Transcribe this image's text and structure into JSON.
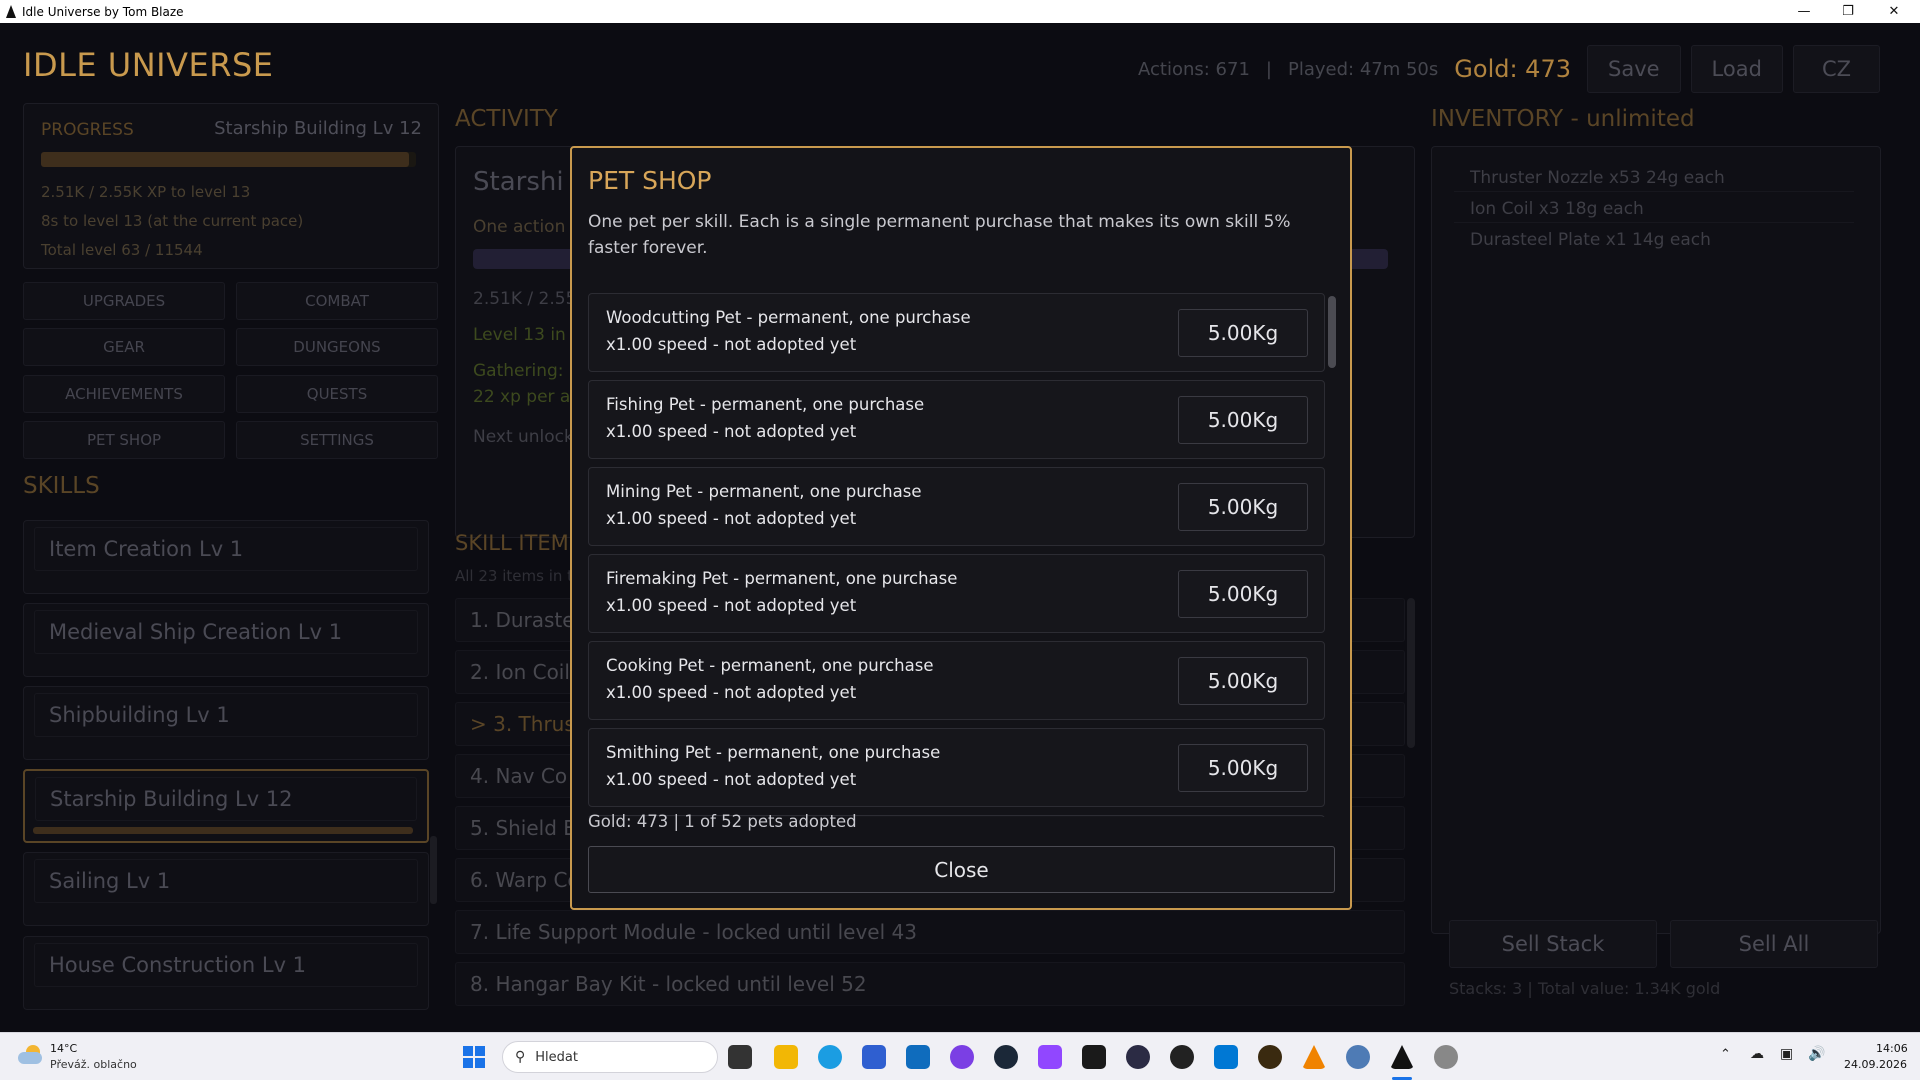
{
  "window": {
    "title": "Idle Universe by Tom Blaze"
  },
  "brand": "IDLE UNIVERSE",
  "topbar": {
    "actions": "Actions: 671",
    "sep": "|",
    "played": "Played: 47m 50s",
    "gold": "Gold: 473",
    "save": "Save",
    "load": "Load",
    "lang": "CZ"
  },
  "progress": {
    "label": "PROGRESS",
    "skill": "Starship Building  Lv 12",
    "xp": "2.51K / 2.55K XP to level 13",
    "eta": "8s to level 13  (at the current pace)",
    "total": "Total level 63 / 11544",
    "fill": 0.98
  },
  "nav": [
    "UPGRADES",
    "COMBAT",
    "GEAR",
    "DUNGEONS",
    "ACHIEVEMENTS",
    "QUESTS",
    "PET SHOP",
    "SETTINGS"
  ],
  "skills_header": "SKILLS",
  "skills": [
    "Item Creation     Lv 1",
    "Medieval Ship Creation     Lv 1",
    "Shipbuilding     Lv 1",
    "Starship Building     Lv 12",
    "Sailing     Lv 1",
    "House Construction     Lv 1"
  ],
  "activity": {
    "header": "ACTIVITY",
    "title": "Starshi",
    "one_action": "One action",
    "xp": "2.51K / 2.55",
    "level": "Level 13 in a",
    "gathering": "Gathering: ",
    "xp_per": "22 xp per a",
    "next_unlock": "Next unlock"
  },
  "skill_items": {
    "header": "SKILL ITEMS",
    "sub": "All 23 items in t",
    "rows": [
      "1. Duraste",
      "2. Ion Coil",
      "> 3. Thrust",
      "4. Nav Co",
      "5. Shield E",
      "6. Warp Co",
      "7. Life Support Module   -   locked until level 43",
      "8. Hangar Bay Kit   -   locked until level 52"
    ]
  },
  "inventory": {
    "header": "INVENTORY - unlimited",
    "rows": [
      "Thruster Nozzle   x53   24g each",
      "Ion Coil   x3   18g each",
      "Durasteel Plate   x1   14g each"
    ],
    "sell_stack": "Sell Stack",
    "sell_all": "Sell All",
    "footer": "Stacks: 3   |   Total value: 1.34K gold"
  },
  "modal": {
    "title": "PET SHOP",
    "desc": "One pet per skill. Each is a single permanent purchase that makes its own skill 5% faster forever.",
    "pets": [
      {
        "line1": "Woodcutting Pet   -   permanent, one purchase",
        "line2": "x1.00 speed   -   not adopted yet",
        "price": "5.00Kg"
      },
      {
        "line1": "Fishing Pet   -   permanent, one purchase",
        "line2": "x1.00 speed   -   not adopted yet",
        "price": "5.00Kg"
      },
      {
        "line1": "Mining Pet   -   permanent, one purchase",
        "line2": "x1.00 speed   -   not adopted yet",
        "price": "5.00Kg"
      },
      {
        "line1": "Firemaking Pet   -   permanent, one purchase",
        "line2": "x1.00 speed   -   not adopted yet",
        "price": "5.00Kg"
      },
      {
        "line1": "Cooking Pet   -   permanent, one purchase",
        "line2": "x1.00 speed   -   not adopted yet",
        "price": "5.00Kg"
      },
      {
        "line1": "Smithing Pet   -   permanent, one purchase",
        "line2": "x1.00 speed   -   not adopted yet",
        "price": "5.00Kg"
      }
    ],
    "footer": "Gold: 473   |   1 of 52 pets adopted",
    "close": "Close"
  },
  "taskbar": {
    "weather_temp": "14°C",
    "weather_desc": "Převáž. oblačno",
    "search_placeholder": "Hledat",
    "time": "14:06",
    "date": "24.09.2026"
  }
}
